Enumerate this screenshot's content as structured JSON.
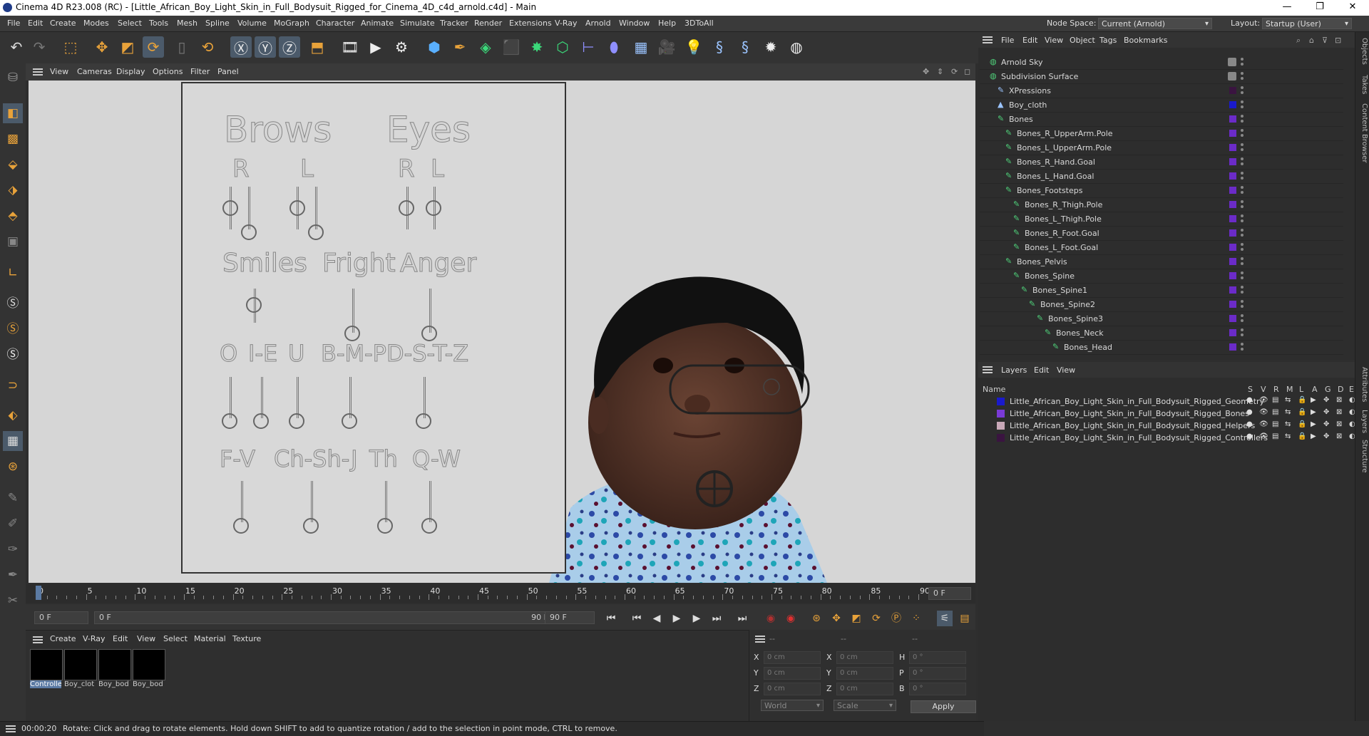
{
  "window": {
    "title": "Cinema 4D R23.008 (RC) - [Little_African_Boy_Light_Skin_in_Full_Bodysuit_Rigged_for_Cinema_4D_c4d_arnold.c4d] - Main"
  },
  "menubar": {
    "items": [
      "File",
      "Edit",
      "Create",
      "Modes",
      "Select",
      "Tools",
      "Mesh",
      "Spline",
      "Volume",
      "MoGraph",
      "Character",
      "Animate",
      "Simulate",
      "Tracker",
      "Render",
      "Extensions",
      "V-Ray",
      "Arnold",
      "Window",
      "Help",
      "3DToAll"
    ],
    "node_space_label": "Node Space:",
    "node_space_value": "Current (Arnold)",
    "layout_label": "Layout:",
    "layout_value": "Startup (User)"
  },
  "viewport": {
    "menu": [
      "View",
      "Cameras",
      "Display",
      "Options",
      "Filter",
      "Panel"
    ],
    "face_panel": {
      "brows": "Brows",
      "eyes": "Eyes",
      "r": "R",
      "l": "L",
      "smiles": "Smiles",
      "fright": "Fright",
      "anger": "Anger",
      "visemes_row1": [
        "O",
        "I-E",
        "U",
        "B-M-P",
        "D-S-T-Z"
      ],
      "visemes_row2": [
        "F-V",
        "Ch-Sh-J",
        "Th",
        "Q-W"
      ]
    }
  },
  "timeline": {
    "ticks": [
      0,
      5,
      10,
      15,
      20,
      25,
      30,
      35,
      40,
      45,
      50,
      55,
      60,
      65,
      70,
      75,
      80,
      85,
      90
    ],
    "current_frame": "0 F"
  },
  "transport": {
    "start": "0 F",
    "current": "0 F",
    "end": "90 F",
    "end2": "90 F"
  },
  "material_manager": {
    "menu": [
      "Create",
      "V-Ray",
      "Edit",
      "View",
      "Select",
      "Material",
      "Texture"
    ],
    "materials": [
      "Controlle",
      "Boy_clot",
      "Boy_bod",
      "Boy_bod"
    ]
  },
  "coordinates": {
    "header_left": "--",
    "header_mid": "--",
    "header_right": "--",
    "rows": [
      {
        "a": "X",
        "av": "0 cm",
        "b": "X",
        "bv": "0 cm",
        "c": "H",
        "cv": "0 °"
      },
      {
        "a": "Y",
        "av": "0 cm",
        "b": "Y",
        "bv": "0 cm",
        "c": "P",
        "cv": "0 °"
      },
      {
        "a": "Z",
        "av": "0 cm",
        "b": "Z",
        "bv": "0 cm",
        "c": "B",
        "cv": "0 °"
      }
    ],
    "mode1": "World",
    "mode2": "Scale",
    "apply": "Apply"
  },
  "status": {
    "time": "00:00:20",
    "message": "Rotate: Click and drag to rotate elements. Hold down SHIFT to add to quantize rotation / add to the selection in point mode, CTRL to remove."
  },
  "object_manager": {
    "menu": [
      "File",
      "Edit",
      "View",
      "Object",
      "Tags",
      "Bookmarks"
    ],
    "objects": [
      {
        "name": "Arnold Sky",
        "indent": 0
      },
      {
        "name": "Subdivision Surface",
        "indent": 0
      },
      {
        "name": "XPressions",
        "indent": 1
      },
      {
        "name": "Boy_cloth",
        "indent": 1
      },
      {
        "name": "Bones",
        "indent": 1
      },
      {
        "name": "Bones_R_UpperArm.Pole",
        "indent": 2
      },
      {
        "name": "Bones_L_UpperArm.Pole",
        "indent": 2
      },
      {
        "name": "Bones_R_Hand.Goal",
        "indent": 2
      },
      {
        "name": "Bones_L_Hand.Goal",
        "indent": 2
      },
      {
        "name": "Bones_Footsteps",
        "indent": 2
      },
      {
        "name": "Bones_R_Thigh.Pole",
        "indent": 3
      },
      {
        "name": "Bones_L_Thigh.Pole",
        "indent": 3
      },
      {
        "name": "Bones_R_Foot.Goal",
        "indent": 3
      },
      {
        "name": "Bones_L_Foot.Goal",
        "indent": 3
      },
      {
        "name": "Bones_Pelvis",
        "indent": 2
      },
      {
        "name": "Bones_Spine",
        "indent": 3
      },
      {
        "name": "Bones_Spine1",
        "indent": 4
      },
      {
        "name": "Bones_Spine2",
        "indent": 5
      },
      {
        "name": "Bones_Spine3",
        "indent": 6
      },
      {
        "name": "Bones_Neck",
        "indent": 7
      },
      {
        "name": "Bones_Head",
        "indent": 8
      }
    ]
  },
  "layer_manager": {
    "menu": [
      "Layers",
      "Edit",
      "View"
    ],
    "name_col": "Name",
    "cols": [
      "S",
      "V",
      "R",
      "M",
      "L",
      "A",
      "G",
      "D",
      "E"
    ],
    "layers": [
      {
        "name": "Little_African_Boy_Light_Skin_in_Full_Bodysuit_Rigged_Geometry",
        "color": "#1a1acc"
      },
      {
        "name": "Little_African_Boy_Light_Skin_in_Full_Bodysuit_Rigged_Bones",
        "color": "#7a3ad6"
      },
      {
        "name": "Little_African_Boy_Light_Skin_in_Full_Bodysuit_Rigged_Helpers",
        "color": "#c8a8b8"
      },
      {
        "name": "Little_African_Boy_Light_Skin_in_Full_Bodysuit_Rigged_Controllers",
        "color": "#3a1440"
      }
    ]
  },
  "side_tabs": [
    "Objects",
    "Takes",
    "Content Browser",
    "Attributes",
    "Layers",
    "Structure"
  ]
}
